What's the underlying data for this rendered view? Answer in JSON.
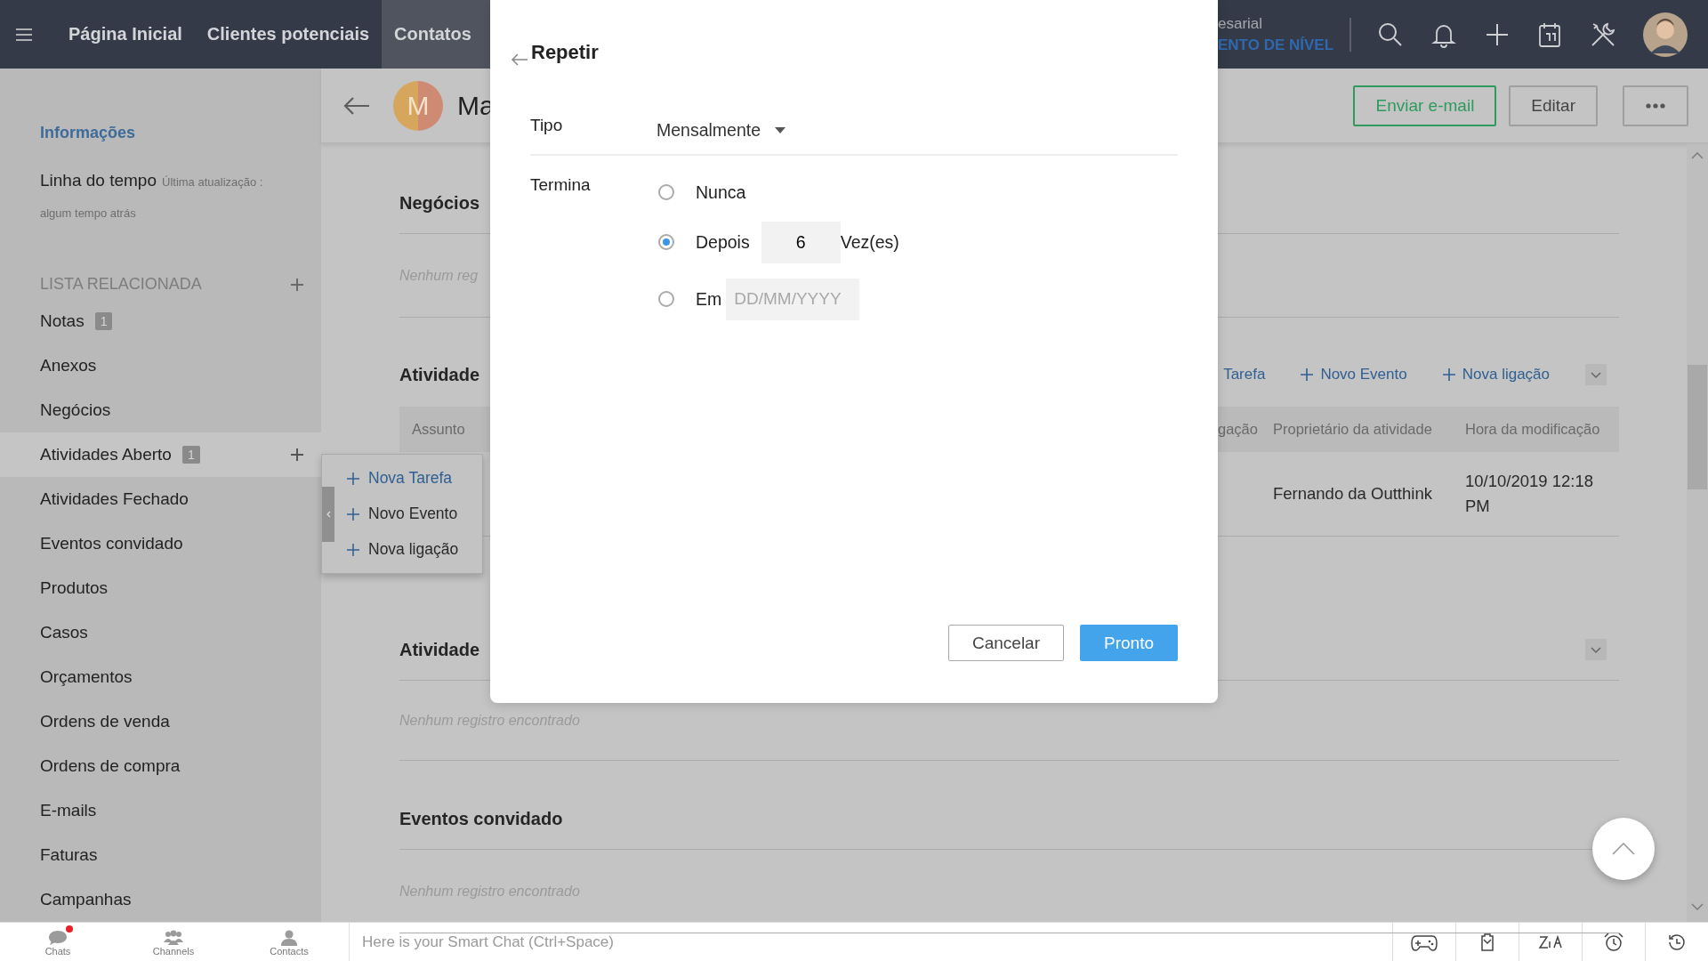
{
  "top_nav": {
    "items": [
      {
        "label": "Página Inicial",
        "selected": false
      },
      {
        "label": "Clientes potenciais",
        "selected": false
      },
      {
        "label": "Contatos",
        "selected": true
      }
    ],
    "org_name": "esarial",
    "upgrade_link": "ENTO DE NÍVEL"
  },
  "sidebar": {
    "info_link": "Informações",
    "timeline_label": "Linha do tempo",
    "timeline_note": "Última atualização :",
    "timeline_time": "algum tempo atrás",
    "related_heading": "LISTA RELACIONADA",
    "items": [
      {
        "label": "Notas",
        "count": "1",
        "selected": false,
        "addable": false
      },
      {
        "label": "Anexos",
        "selected": false,
        "addable": false
      },
      {
        "label": "Negócios",
        "selected": false,
        "addable": false
      },
      {
        "label": "Atividades Aberto",
        "count": "1",
        "selected": true,
        "addable": true
      },
      {
        "label": "Atividades Fechado",
        "selected": false,
        "addable": false
      },
      {
        "label": "Eventos convidado",
        "selected": false,
        "addable": false
      },
      {
        "label": "Produtos",
        "selected": false,
        "addable": false
      },
      {
        "label": "Casos",
        "selected": false,
        "addable": false
      },
      {
        "label": "Orçamentos",
        "selected": false,
        "addable": false
      },
      {
        "label": "Ordens de venda",
        "selected": false,
        "addable": false
      },
      {
        "label": "Ordens de compra",
        "selected": false,
        "addable": false
      },
      {
        "label": "E-mails",
        "selected": false,
        "addable": false
      },
      {
        "label": "Faturas",
        "selected": false,
        "addable": false
      },
      {
        "label": "Campanhas",
        "selected": false,
        "addable": false
      }
    ]
  },
  "add_menu": {
    "items": [
      {
        "label": "Nova Tarefa",
        "selected": true
      },
      {
        "label": "Novo Evento",
        "selected": false
      },
      {
        "label": "Nova ligação",
        "selected": false
      }
    ]
  },
  "record": {
    "avatar_letter": "M",
    "name": "Ma",
    "buttons": [
      {
        "label": "Enviar e-mail",
        "kind": "primary"
      },
      {
        "label": "Editar",
        "kind": "plain"
      }
    ]
  },
  "sections": [
    {
      "kind": "empty",
      "title": "Negócios",
      "collapsible": false,
      "empty_text": "Nenhum reg"
    },
    {
      "kind": "table",
      "title": "Atividade",
      "collapsible": true,
      "actions": [
        {
          "label": "Tarefa",
          "plus": false
        },
        {
          "label": "Novo Evento",
          "plus": true
        },
        {
          "label": "Nova ligação",
          "plus": true
        }
      ],
      "columns": [
        "Assunto",
        "gação",
        "Proprietário da atividade",
        "Hora da modificação"
      ],
      "rows": [
        {
          "owner": "Fernando da Outthink",
          "modified": "10/10/2019 12:18 PM"
        }
      ]
    },
    {
      "kind": "empty",
      "title": "Atividade",
      "collapsible": true,
      "empty_text": "Nenhum registro encontrado"
    },
    {
      "kind": "empty",
      "title": "Eventos convidado",
      "collapsible": false,
      "empty_text": "Nenhum registro encontrado"
    }
  ],
  "dialog": {
    "title": "Repetir",
    "type_label": "Tipo",
    "type_value": "Mensalmente",
    "ends_label": "Termina",
    "options": [
      {
        "kind": "plain",
        "label": "Nunca",
        "selected": false
      },
      {
        "kind": "count",
        "label": "Depois",
        "value": "6",
        "suffix": "Vez(es)",
        "selected": true
      },
      {
        "kind": "date",
        "label": "Em",
        "placeholder": "DD/MM/YYYY",
        "selected": false
      }
    ],
    "buttons": [
      {
        "label": "Cancelar",
        "kind": "secondary"
      },
      {
        "label": "Pronto",
        "kind": "primary"
      }
    ]
  },
  "bottom_bar": {
    "apps": [
      {
        "label": "Chats",
        "unread": true
      },
      {
        "label": "Channels",
        "unread": false
      },
      {
        "label": "Contacts",
        "unread": false
      }
    ],
    "chat_placeholder": "Here is your Smart Chat (Ctrl+Space)"
  }
}
